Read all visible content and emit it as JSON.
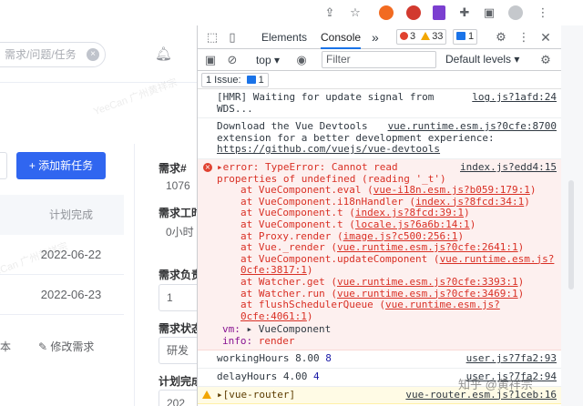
{
  "chrome": {
    "icons": [
      "share-icon",
      "star-icon",
      "extension-orange-icon",
      "extension-red-icon",
      "extension-purple-icon",
      "puzzle-icon",
      "sidepanel-icon",
      "profile-icon",
      "menu-icon"
    ]
  },
  "app": {
    "search_placeholder": "需求/问题/任务",
    "search_clear": "×",
    "watermark_text": "YeeCan 广州黄祥宗",
    "add_task_label": "+ 添加新任务",
    "plan_complete_header": "计划完成",
    "rows": [
      "2022-06-22",
      "2022-06-23"
    ],
    "bottom_left_text": "本",
    "edit_requirement_label": "修改需求",
    "side_fields": [
      {
        "label": "需求#",
        "value": "1076"
      },
      {
        "label": "需求工时",
        "value": "0小时"
      },
      {
        "label": "需求负责",
        "value": "1"
      },
      {
        "label": "需求状态",
        "value": "研发"
      },
      {
        "label": "计划完成",
        "value": "202"
      }
    ]
  },
  "devtools": {
    "tabs": [
      "Elements",
      "Console"
    ],
    "more_tabs": "»",
    "badges": {
      "errors": "3",
      "warnings": "33",
      "issues": "1"
    },
    "context": "top",
    "filter_placeholder": "Filter",
    "levels_label": "Default levels ▾",
    "issues_label": "1 Issue:",
    "issues_count": "1",
    "messages": {
      "hmr": {
        "text": "[HMR] Waiting for update signal from WDS...",
        "src": "log.js?1afd:24"
      },
      "devtools": {
        "text": "Download the Vue Devtools extension for a better development experience:",
        "link": "https://github.com/vuejs/vue-devtools",
        "src": "vue.runtime.esm.js?0cfe:8700"
      },
      "error": {
        "head": "▸error:  TypeError: Cannot read properties of undefined (reading '_t')",
        "src": "index.js?edd4:15",
        "frames": [
          {
            "fn": "at VueComponent.eval",
            "loc": "vue-i18n.esm.js?b059:179:1"
          },
          {
            "fn": "at VueComponent.i18nHandler",
            "loc": "index.js?8fcd:34:1"
          },
          {
            "fn": "at VueComponent.t",
            "loc": "index.js?8fcd:39:1"
          },
          {
            "fn": "at VueComponent.t",
            "loc": "locale.js?6a6b:14:1"
          },
          {
            "fn": "at Proxy.render",
            "loc": "image.js?c500:256:1"
          },
          {
            "fn": "at Vue._render",
            "loc": "vue.runtime.esm.js?0cfe:2641:1"
          },
          {
            "fn": "at VueComponent.updateComponent",
            "loc": "vue.runtime.esm.js?0cfe:3817:1"
          },
          {
            "fn": "at Watcher.get",
            "loc": "vue.runtime.esm.js?0cfe:3393:1"
          },
          {
            "fn": "at Watcher.run",
            "loc": "vue.runtime.esm.js?0cfe:3469:1"
          },
          {
            "fn": "at flushSchedulerQueue",
            "loc": "vue.runtime.esm.js?0cfe:4061:1"
          }
        ],
        "vm_key": "vm:",
        "vm_val": "▸ VueComponent",
        "info_key": "info:",
        "info_val": "render"
      },
      "working": {
        "label": "workingHours 8.00",
        "num": "8",
        "src": "user.js?7fa2:93"
      },
      "delay": {
        "label": "delayHours 4.00",
        "num": "4",
        "src": "user.js?7fa2:94"
      },
      "router": {
        "text": "▸[vue-router]",
        "src": "vue-router.esm.js?1ceb:16"
      }
    },
    "bottom_watermark": "知乎 @黄祥宗"
  }
}
